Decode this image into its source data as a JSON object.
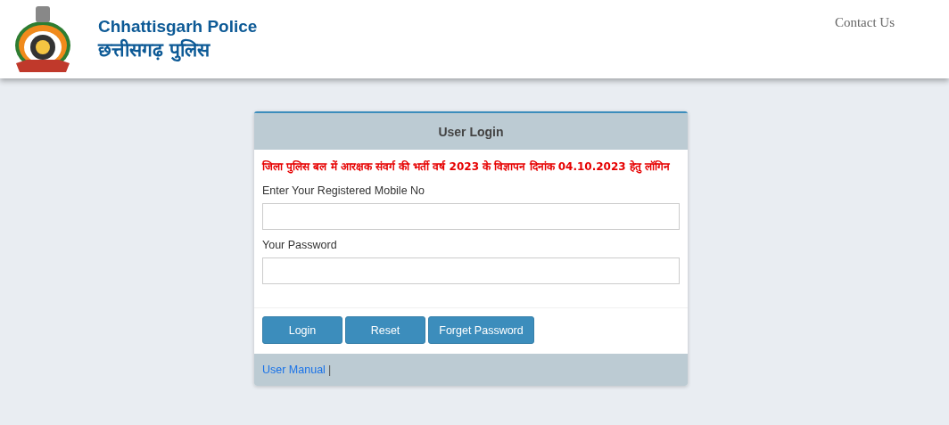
{
  "header": {
    "title": "Chhattisgarh Police",
    "subtitle": "छत्तीसगढ़ पुलिस",
    "nav": [
      "Contact Us"
    ]
  },
  "login": {
    "title": "User Login",
    "notice": "जिला पुलिस बल में आरक्षक संवर्ग की भर्ती वर्ष 2023 के विज्ञापन दिनांक 04.10.2023 हेतु लॉगिन",
    "fields": [
      {
        "label": "Enter Your Registered Mobile No"
      },
      {
        "label": "Your Password"
      }
    ],
    "buttons": [
      "Login",
      "Reset",
      "Forget Password"
    ],
    "footer": {
      "link": "User Manual",
      "separator": "|"
    }
  }
}
